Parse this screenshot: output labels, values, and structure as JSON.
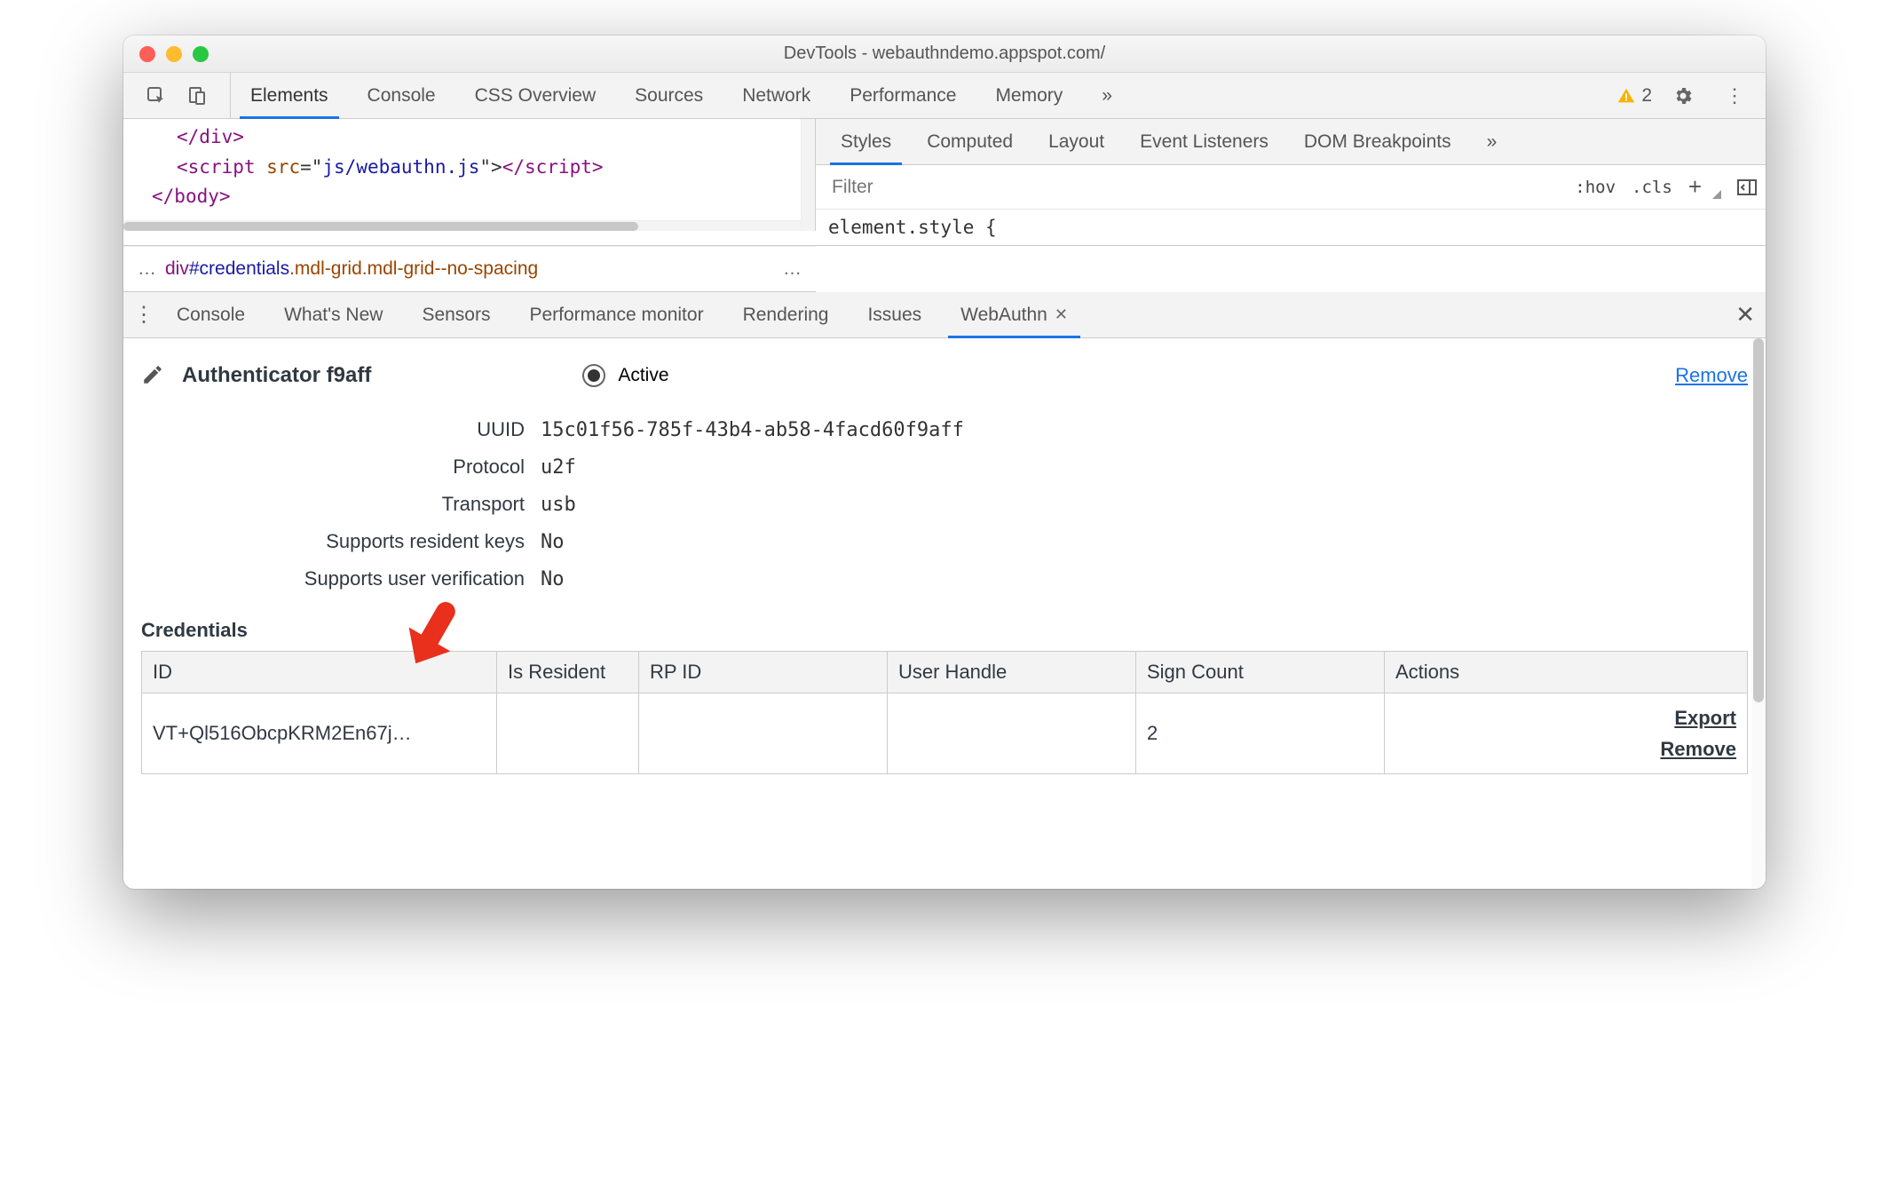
{
  "window": {
    "title": "DevTools - webauthndemo.appspot.com/"
  },
  "main_tabs": [
    "Elements",
    "Console",
    "CSS Overview",
    "Sources",
    "Network",
    "Performance",
    "Memory"
  ],
  "main_tabs_more": "»",
  "warning_count": "2",
  "code": {
    "l1a": "</",
    "l1b": "div",
    "l1c": ">",
    "l2a": "<",
    "l2b": "script",
    "l2c": " src",
    "l2d": "=\"",
    "l2e": "js/webauthn.js",
    "l2f": "\">",
    "l2g": "</",
    "l2h": "script",
    "l2i": ">",
    "l3a": "</",
    "l3b": "body",
    "l3c": ">"
  },
  "breadcrumb": {
    "ell1": "…",
    "tag": "div",
    "hash": "#credentials",
    "cls": ".mdl-grid.mdl-grid--no-spacing",
    "ell2": "…"
  },
  "styles_tabs": [
    "Styles",
    "Computed",
    "Layout",
    "Event Listeners",
    "DOM Breakpoints"
  ],
  "styles_tabs_more": "»",
  "filter_placeholder": "Filter",
  "styles_btn_hov": ":hov",
  "styles_btn_cls": ".cls",
  "styles_body": "element.style {",
  "drawer_tabs": [
    "Console",
    "What's New",
    "Sensors",
    "Performance monitor",
    "Rendering",
    "Issues",
    "WebAuthn"
  ],
  "auth": {
    "title": "Authenticator f9aff",
    "active_label": "Active",
    "remove": "Remove",
    "rows": [
      {
        "label": "UUID",
        "value": "15c01f56-785f-43b4-ab58-4facd60f9aff"
      },
      {
        "label": "Protocol",
        "value": "u2f"
      },
      {
        "label": "Transport",
        "value": "usb"
      },
      {
        "label": "Supports resident keys",
        "value": "No"
      },
      {
        "label": "Supports user verification",
        "value": "No"
      }
    ]
  },
  "credentials": {
    "title": "Credentials",
    "headers": [
      "ID",
      "Is Resident",
      "RP ID",
      "User Handle",
      "Sign Count",
      "Actions"
    ],
    "row": {
      "id": "VT+Ql516ObcpKRM2En67j…",
      "is_resident": "",
      "rp_id": "",
      "user_handle": "",
      "sign_count": "2",
      "export": "Export",
      "remove": "Remove"
    }
  }
}
